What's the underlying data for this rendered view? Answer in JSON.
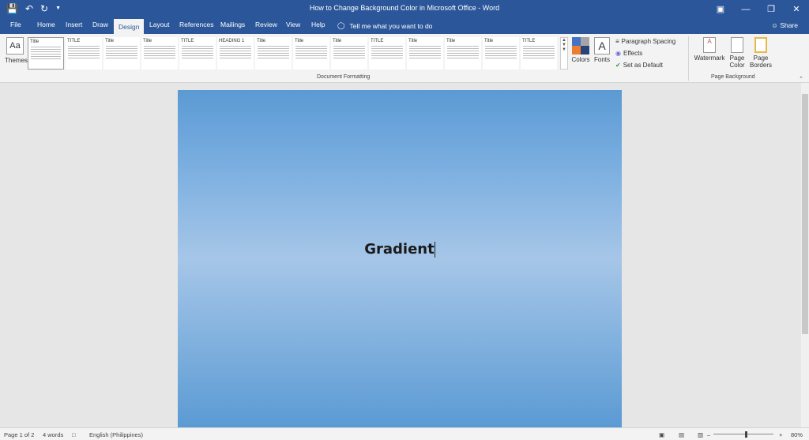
{
  "titlebar": {
    "title": "How to Change Background Color in Microsoft Office  -  Word",
    "save_icon": "save-icon",
    "undo_icon": "undo-icon",
    "redo_icon": "redo-icon"
  },
  "tabs": [
    "File",
    "Home",
    "Insert",
    "Draw",
    "Design",
    "Layout",
    "References",
    "Mailings",
    "Review",
    "View",
    "Help"
  ],
  "active_tab": "Design",
  "tellme": "Tell me what you want to do",
  "share": "Share",
  "ribbon": {
    "themes_label": "Themes",
    "styles": [
      "Title",
      "TITLE",
      "Title",
      "Title",
      "TITLE",
      "HEADING 1",
      "Title",
      "Title",
      "Title",
      "TITLE",
      "Title",
      "Title",
      "Title",
      "TITLE"
    ],
    "document_formatting_label": "Document Formatting",
    "colors_label": "Colors",
    "fonts_label": "Fonts",
    "paragraph_spacing_label": "Paragraph Spacing",
    "effects_label": "Effects",
    "set_default_label": "Set as Default",
    "watermark_label": "Watermark",
    "page_color_label": "Page Color",
    "page_borders_label": "Page Borders",
    "page_background_label": "Page Background"
  },
  "document": {
    "text": "Gradient"
  },
  "status": {
    "page": "Page 1 of 2",
    "words": "4 words",
    "language": "English (Philippines)",
    "zoom": "80%"
  },
  "colors": {
    "brand": "#2b579a",
    "gradient_dark": "#5b9ad4",
    "gradient_light": "#a6c6e8"
  }
}
